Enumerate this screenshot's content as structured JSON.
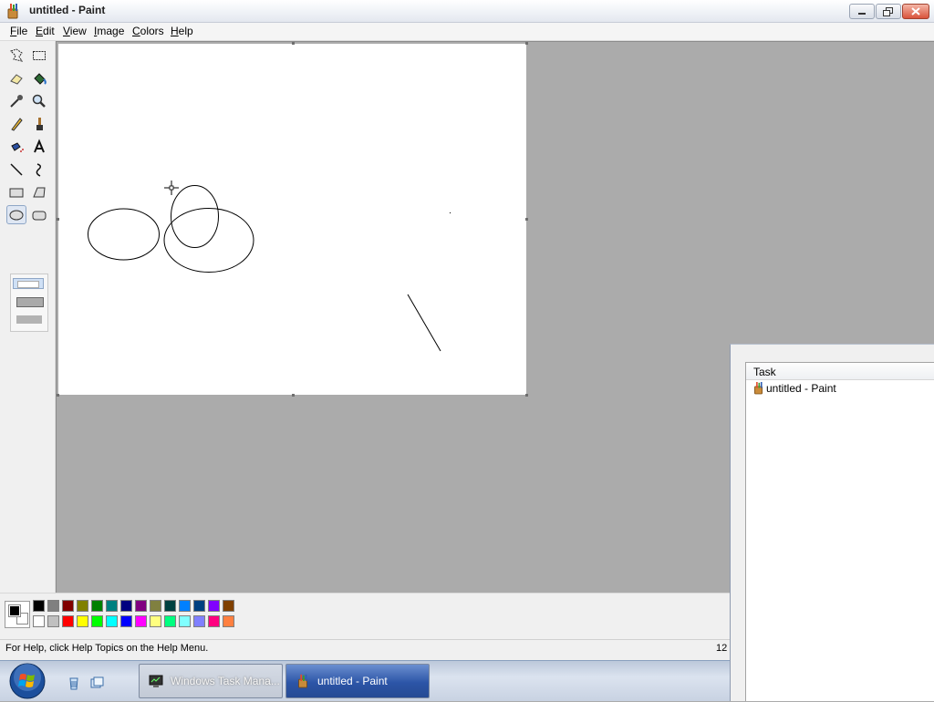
{
  "window": {
    "title": "untitled - Paint"
  },
  "menu": [
    {
      "label": "File",
      "u": "F",
      "rest": "ile"
    },
    {
      "label": "Edit",
      "u": "E",
      "rest": "dit"
    },
    {
      "label": "View",
      "u": "V",
      "rest": "iew"
    },
    {
      "label": "Image",
      "u": "I",
      "rest": "mage"
    },
    {
      "label": "Colors",
      "u": "C",
      "rest": "olors"
    },
    {
      "label": "Help",
      "u": "H",
      "rest": "elp"
    }
  ],
  "tools": [
    "free-form-select-icon",
    "select-icon",
    "eraser-icon",
    "fill-icon",
    "pick-color-icon",
    "magnifier-icon",
    "pencil-icon",
    "brush-icon",
    "airbrush-icon",
    "text-icon",
    "line-icon",
    "curve-icon",
    "rectangle-icon",
    "polygon-icon",
    "ellipse-icon",
    "rounded-rectangle-icon"
  ],
  "active_tool": "ellipse-icon",
  "palette": {
    "foreground": "#000000",
    "background": "#ffffff",
    "top_row": [
      "#000000",
      "#808080",
      "#800000",
      "#808000",
      "#008000",
      "#008080",
      "#000080",
      "#800080",
      "#808040",
      "#004040",
      "#0080ff",
      "#004080",
      "#8000ff",
      "#804000"
    ],
    "bottom_row": [
      "#ffffff",
      "#c0c0c0",
      "#ff0000",
      "#ffff00",
      "#00ff00",
      "#00ffff",
      "#0000ff",
      "#ff00ff",
      "#ffff80",
      "#00ff80",
      "#80ffff",
      "#8080ff",
      "#ff0080",
      "#ff8040"
    ]
  },
  "status": {
    "help_text": "For Help, click Help Topics on the Help Menu.",
    "coords": "12"
  },
  "task_manager": {
    "column_header": "Task",
    "rows": [
      {
        "label": "untitled - Paint",
        "icon": "paint-icon"
      }
    ]
  },
  "taskbar": {
    "buttons": [
      {
        "label": "Windows Task Mana...",
        "icon": "task-manager-icon"
      },
      {
        "label": "untitled - Paint",
        "icon": "paint-icon"
      }
    ],
    "quick_launch": [
      "recycle-icon",
      "switch-windows-icon"
    ]
  }
}
